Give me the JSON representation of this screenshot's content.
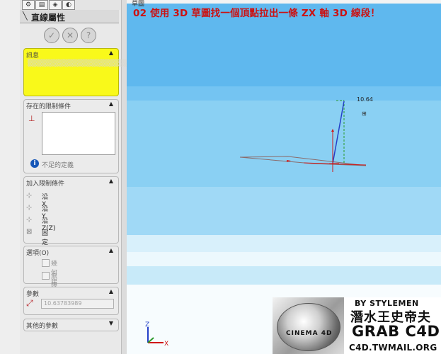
{
  "property_manager": {
    "title": "直線屬性",
    "buttons": {
      "ok": "✓",
      "cancel": "✕",
      "help": "?"
    },
    "message": {
      "title": "訊息",
      "text": "▒▒▒▒▒▒▒▒▒▒▒▒▒▒▒▒▒▒▒▒▒▒▒▒▒▒▒▒▒▒▒▒▒▒▒▒▒▒▒▒▒▒"
    },
    "existing_relations": {
      "title": "存在的限制條件",
      "status": "不足的定義"
    },
    "add_relations": {
      "title": "加入限制條件",
      "items": [
        {
          "icon": "along-x-icon",
          "label": "沿 X"
        },
        {
          "icon": "along-y-icon",
          "label": "沿 Y"
        },
        {
          "icon": "along-z-icon",
          "label": "沿Z(Z)"
        },
        {
          "icon": "fix-icon",
          "label": "固定(F)"
        }
      ]
    },
    "options": {
      "title": "選項(O)",
      "items": [
        {
          "label": "幾何建構線(C)",
          "checked": false
        },
        {
          "label": "無限長度(I)",
          "checked": false
        }
      ]
    },
    "parameters": {
      "title": "參數",
      "length_value": "10.63783989"
    },
    "other_parameters": {
      "title": "其他的參數"
    }
  },
  "viewport": {
    "tab": "草圖",
    "headline": "02 使用 3D 草圖找一個頂點拉出一條 ZX 軸 3D 線段！",
    "dimension_label": "10.64",
    "triad": {
      "z": "Z",
      "x": "X"
    }
  },
  "watermark": {
    "by": "BY STYLEMEN",
    "name": "潛水王史帝夫",
    "grab": "GRAB C4D",
    "logo_text": "CINEMA 4D",
    "site": "C4D.TWMAIL.ORG"
  },
  "colors": {
    "viewport_bg": "#5fb8ee",
    "headline": "#cc1111",
    "message_bg": "#f9f91a",
    "sketch_line": "#2440c8",
    "axis_red": "#d01818",
    "axis_green": "#2a9a2a"
  }
}
